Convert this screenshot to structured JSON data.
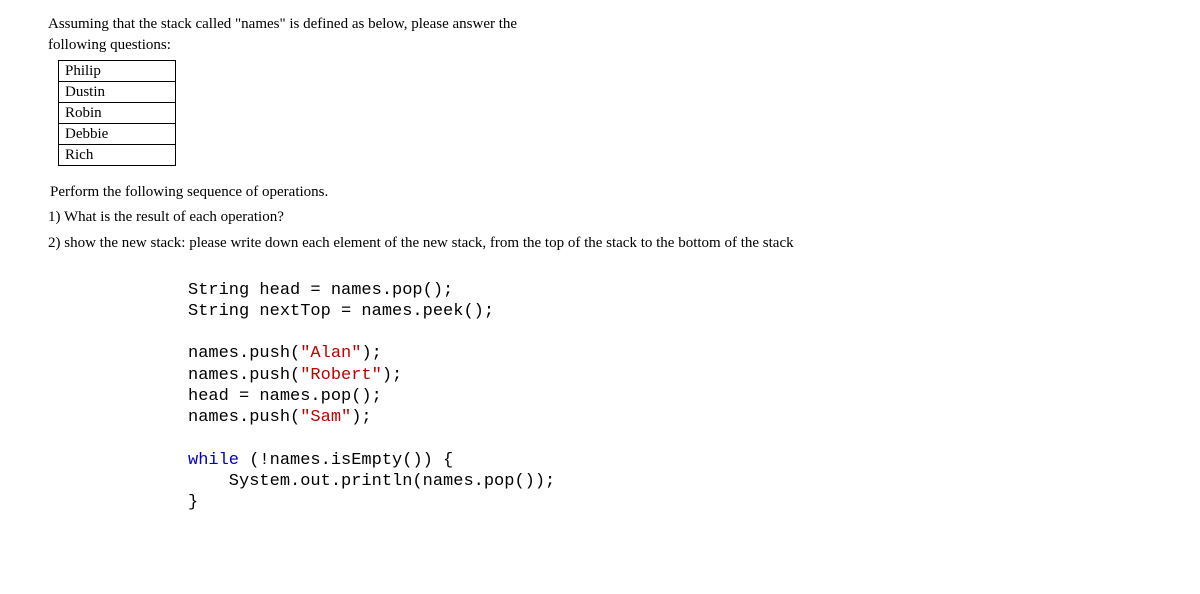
{
  "intro_line1": "Assuming that the stack called \"names\" is defined as below, please answer the",
  "intro_line2": "following questions:",
  "stack": [
    "Philip",
    "Dustin",
    "Robin",
    "Debbie",
    "Rich"
  ],
  "perform": "Perform the following sequence of operations.",
  "q1": "1) What is the result of each operation?",
  "q2": "2) show the new stack: please write down each element of the new stack, from the top of the stack to the bottom of the stack",
  "code": {
    "l1a": "String head = names.pop();",
    "l2a": "String nextTop = names.peek();",
    "l4a": "names.push(",
    "l4s": "\"Alan\"",
    "l4b": ");",
    "l5a": "names.push(",
    "l5s": "\"Robert\"",
    "l5b": ");",
    "l6a": "head = names.pop();",
    "l7a": "names.push(",
    "l7s": "\"Sam\"",
    "l7b": ");",
    "l9a": "while",
    "l9b": " (!names.isEmpty()) {",
    "l10a": "    System.out.println(names.pop());",
    "l11a": "}"
  }
}
